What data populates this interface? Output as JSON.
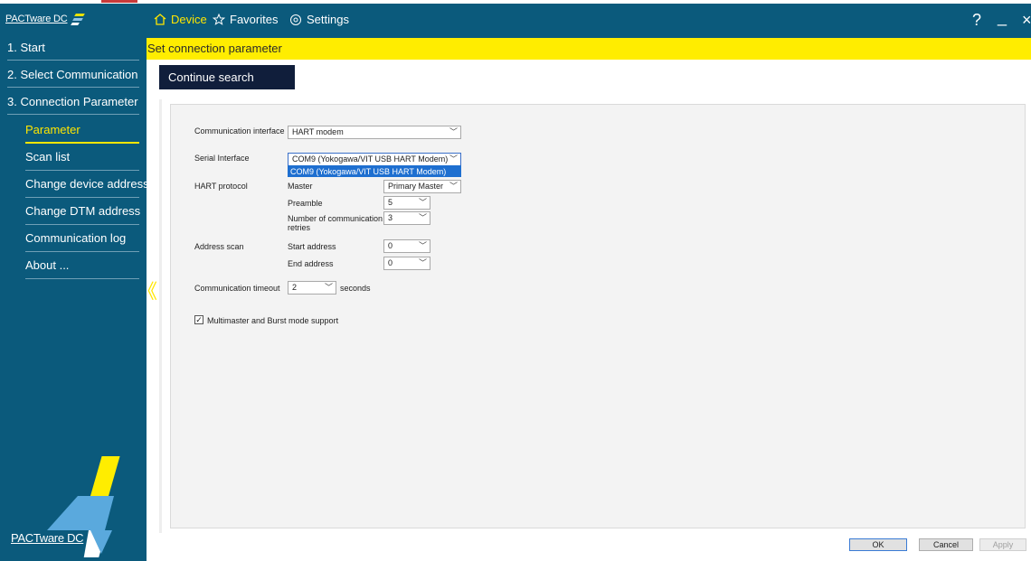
{
  "app": {
    "brand": "PACTware DC",
    "logo_text": "PACTware DC"
  },
  "header": {
    "device_label": "Device",
    "favorites_label": "Favorites",
    "settings_label": "Settings",
    "help_label": "?",
    "minimize_label": "_",
    "close_label": "×"
  },
  "sidebar": {
    "steps": [
      {
        "label": "1. Start"
      },
      {
        "label": "2. Select Communication"
      },
      {
        "label": "3. Connection Parameter"
      }
    ],
    "items": [
      {
        "label": "Parameter",
        "active": true
      },
      {
        "label": "Scan list"
      },
      {
        "label": "Change device address"
      },
      {
        "label": "Change DTM address"
      },
      {
        "label": "Communication log"
      },
      {
        "label": "About ..."
      }
    ],
    "collapse_glyph": "《"
  },
  "band": {
    "title": "Set connection parameter"
  },
  "toolbar": {
    "continue_label": "Continue search"
  },
  "form": {
    "comm_interface": {
      "label": "Communication interface",
      "value": "HART modem"
    },
    "serial_interface": {
      "label": "Serial Interface",
      "value": "COM9 (Yokogawa/VIT USB HART Modem)",
      "option_highlighted": "COM9 (Yokogawa/VIT USB HART Modem)"
    },
    "hart_protocol": {
      "label": "HART protocol",
      "master_label": "Master",
      "master_value": "Primary Master",
      "preamble_label": "Preamble",
      "preamble_value": "5",
      "retries_label_line1": "Number of communication",
      "retries_label_line2": "retries",
      "retries_value": "3"
    },
    "address_scan": {
      "label": "Address scan",
      "start_label": "Start address",
      "start_value": "0",
      "end_label": "End address",
      "end_value": "0"
    },
    "timeout": {
      "label": "Communication timeout",
      "value": "2",
      "unit": "seconds"
    },
    "multimaster": {
      "label": "Multimaster and Burst mode support",
      "checked": true,
      "check_glyph": "✓"
    }
  },
  "footer": {
    "ok": "OK",
    "cancel": "Cancel",
    "apply": "Apply"
  },
  "colors": {
    "sidebar": "#0b5a7c",
    "accent_yellow": "#ffed00",
    "dark_button": "#101e3b",
    "selection_blue": "#1e6fd0"
  }
}
